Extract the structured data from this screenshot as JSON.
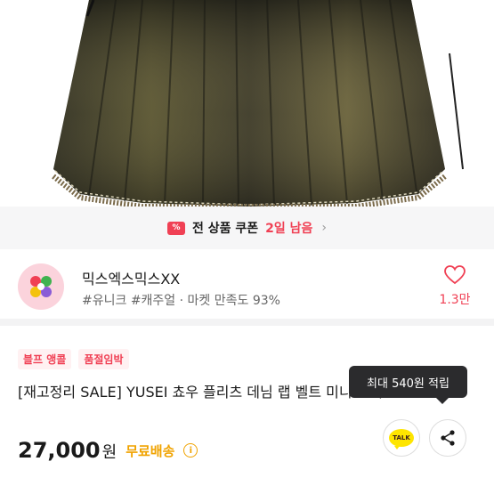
{
  "coupon": {
    "icon": "coupon-icon",
    "icon_text": "%",
    "title": "전 상품 쿠폰",
    "days_left": "2일 남음",
    "chevron": "›"
  },
  "shop": {
    "name": "믹스엑스믹스XX",
    "meta": "#유니크 #캐주얼 · 마켓 만족도 93%",
    "like_count": "1.3만"
  },
  "product": {
    "badges": [
      "블프 앵콜",
      "품절임박"
    ],
    "title": "[재고정리 SALE] YUSEI 쵸우 플리츠 데님 랩 벨트 미니 스커트",
    "price": "27,000",
    "currency": "원",
    "shipping": "무료배송",
    "info_icon": "i"
  },
  "tooltip": {
    "text": "최대 540원 적립"
  },
  "actions": {
    "talk_label": "TALK"
  },
  "colors": {
    "accent": "#f04054",
    "shipping": "#f0a300",
    "tooltip_bg": "#2b2b2d"
  }
}
